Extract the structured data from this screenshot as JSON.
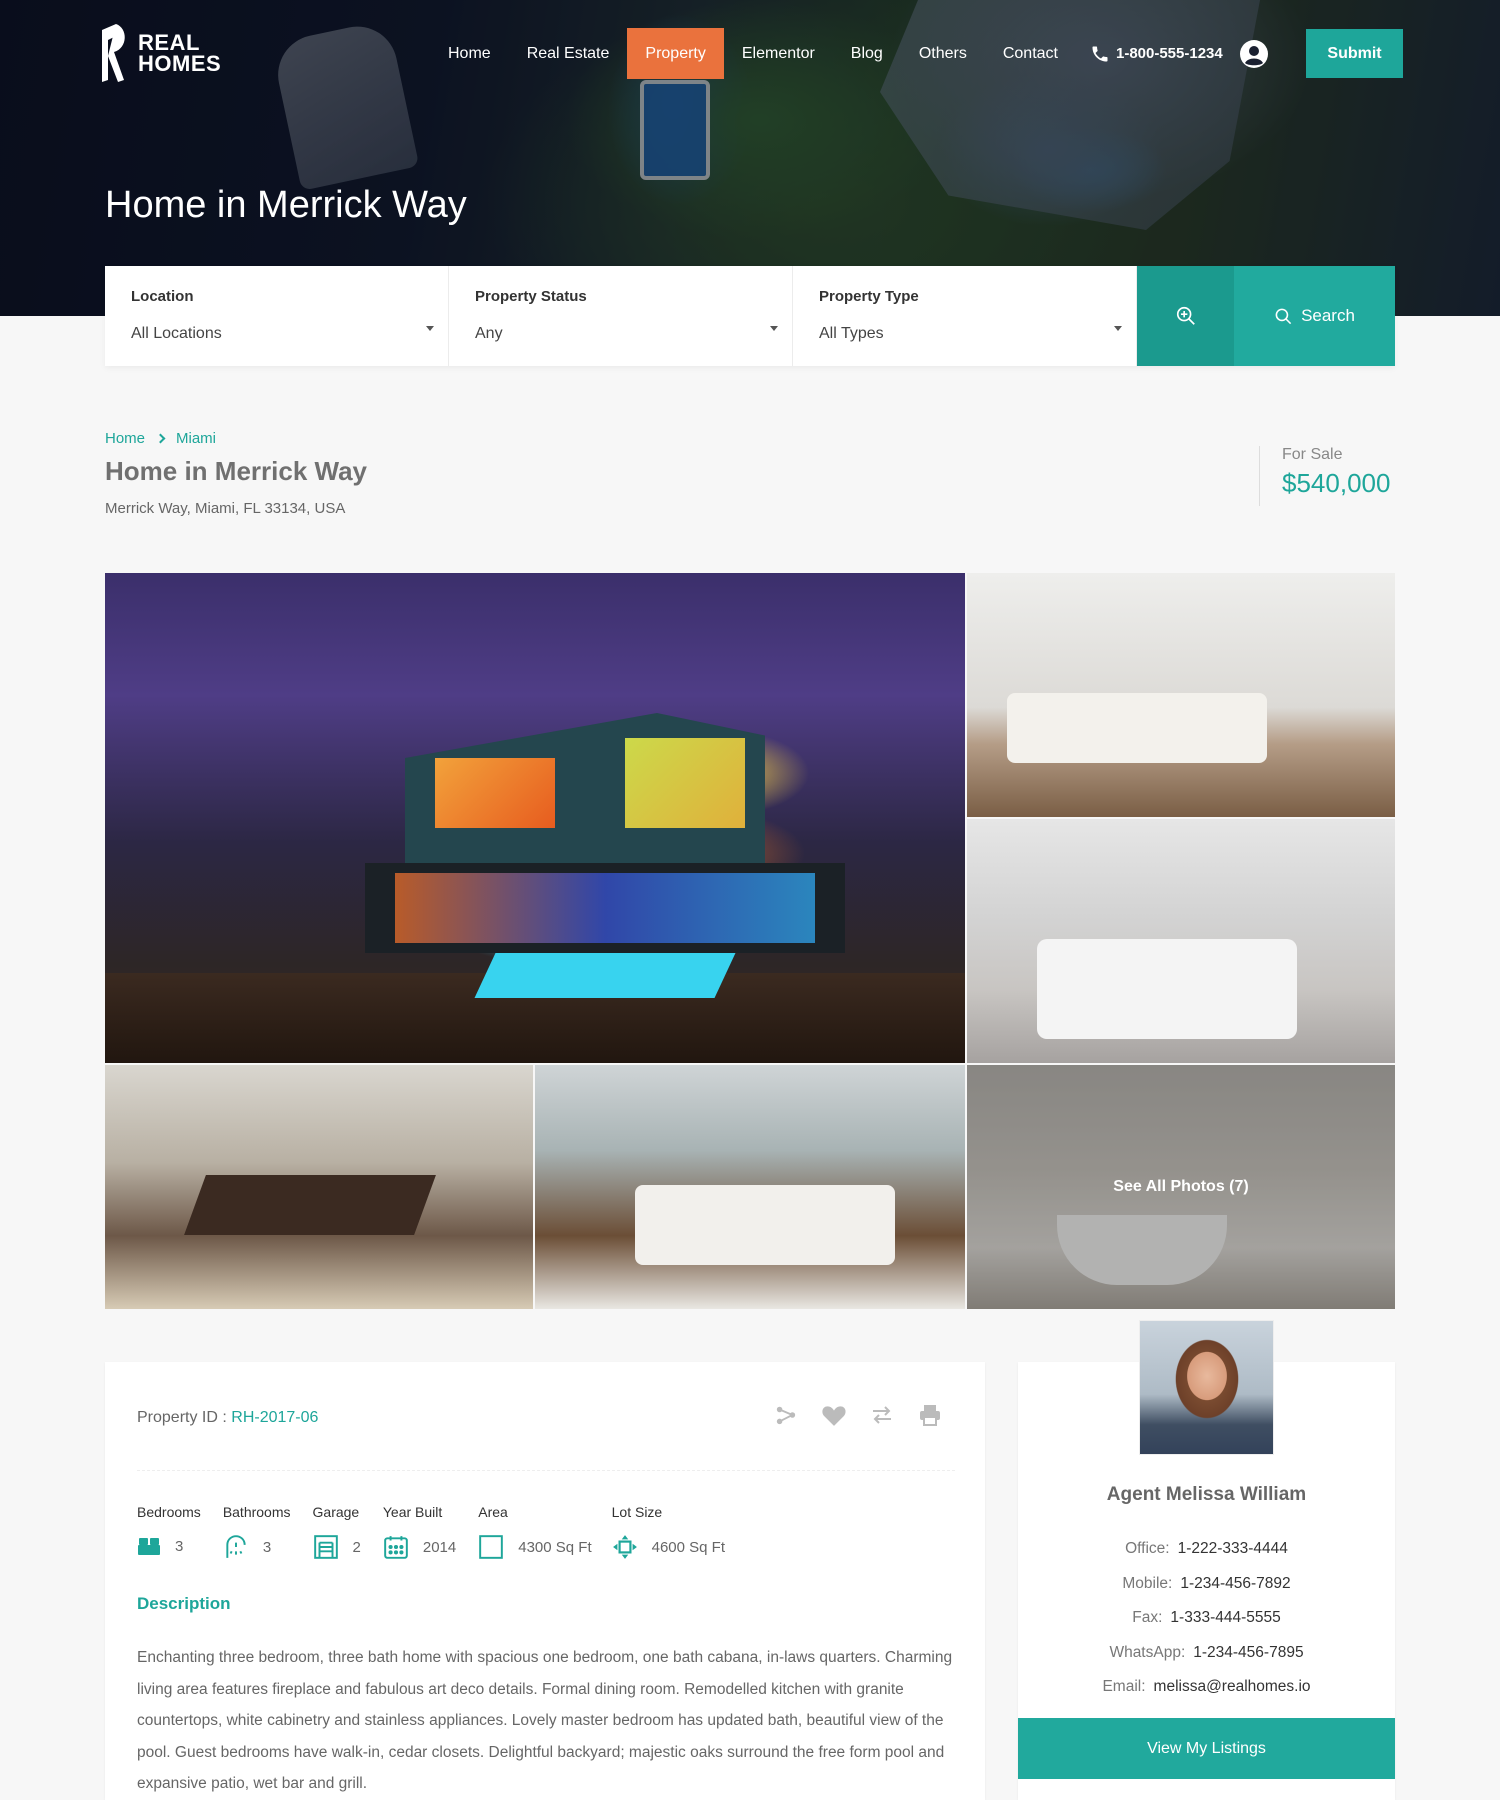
{
  "brand": {
    "line1": "REAL",
    "line2": "HOMES"
  },
  "nav": {
    "items": [
      "Home",
      "Real Estate",
      "Property",
      "Elementor",
      "Blog",
      "Others",
      "Contact"
    ],
    "active": "Property",
    "phone": "1-800-555-1234",
    "submit_label": "Submit"
  },
  "hero": {
    "title": "Home in Merrick Way"
  },
  "search": {
    "location_label": "Location",
    "location_value": "All Locations",
    "status_label": "Property Status",
    "status_value": "Any",
    "type_label": "Property Type",
    "type_value": "All Types",
    "button_label": "Search"
  },
  "breadcrumb": [
    "Home",
    "Miami"
  ],
  "property": {
    "title": "Home in Merrick Way",
    "address": "Merrick Way, Miami, FL 33134, USA",
    "status": "For Sale",
    "price": "$540,000",
    "id_label": "Property ID :",
    "id_value": "RH-2017-06"
  },
  "gallery": {
    "see_all_label": "See All Photos (7)"
  },
  "features": [
    {
      "label": "Bedrooms",
      "value": "3",
      "icon": "bed-icon"
    },
    {
      "label": "Bathrooms",
      "value": "3",
      "icon": "shower-icon"
    },
    {
      "label": "Garage",
      "value": "2",
      "icon": "garage-icon"
    },
    {
      "label": "Year Built",
      "value": "2014",
      "icon": "calendar-icon"
    },
    {
      "label": "Area",
      "value": "4300 Sq Ft",
      "icon": "area-icon"
    },
    {
      "label": "Lot Size",
      "value": "4600 Sq Ft",
      "icon": "lot-size-icon"
    }
  ],
  "description": {
    "heading": "Description",
    "text": "Enchanting three bedroom, three bath home with spacious one bedroom, one bath cabana, in-laws quarters. Charming living area features fireplace and fabulous art deco details. Formal dining room. Remodelled kitchen with granite countertops, white cabinetry and stainless appliances. Lovely master bedroom has updated bath, beautiful view of the pool. Guest bedrooms have walk-in, cedar closets. Delightful backyard; majestic oaks surround the free form pool and expansive patio, wet bar and grill."
  },
  "agent": {
    "name": "Agent Melissa William",
    "office_label": "Office:",
    "office": "1-222-333-4444",
    "mobile_label": "Mobile:",
    "mobile": "1-234-456-7892",
    "fax_label": "Fax:",
    "fax": "1-333-444-5555",
    "whatsapp_label": "WhatsApp:",
    "whatsapp": "1-234-456-7895",
    "email_label": "Email:",
    "email": "melissa@realhomes.io",
    "listings_label": "View My Listings"
  },
  "colors": {
    "accent": "#1ea69a",
    "active_nav": "#ea723d"
  }
}
